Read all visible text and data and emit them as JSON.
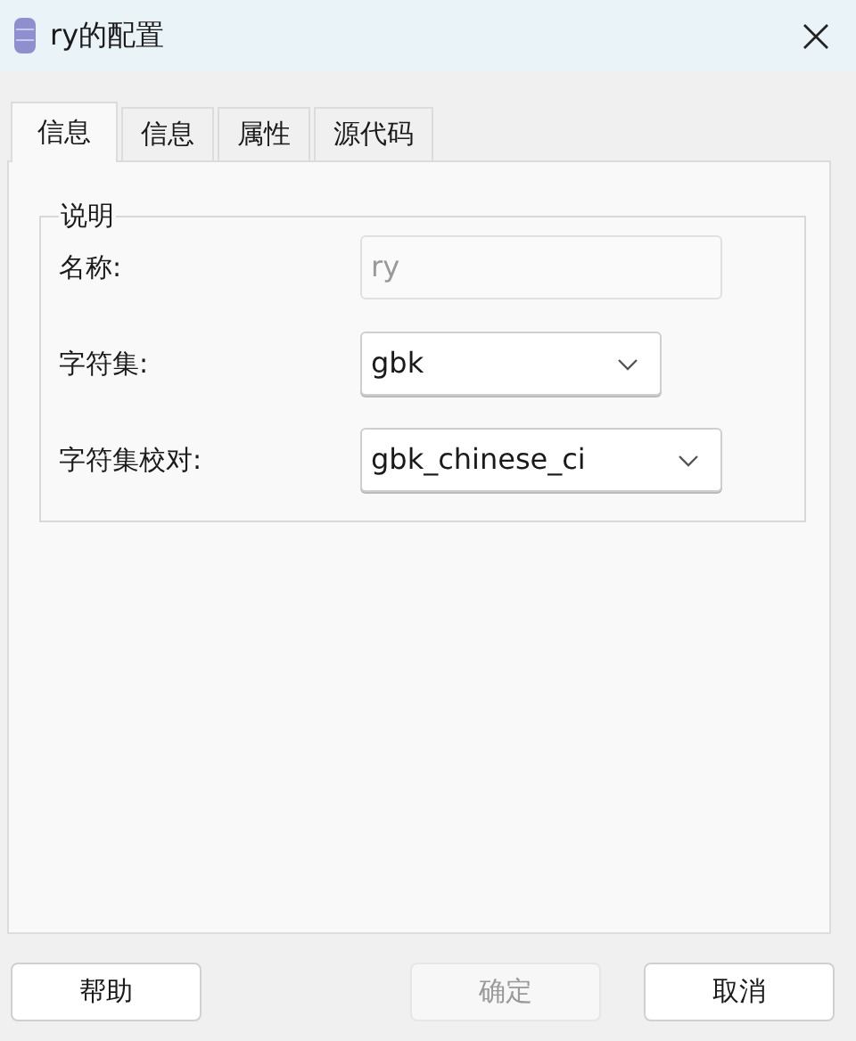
{
  "window": {
    "title": "ry的配置"
  },
  "tabs": [
    {
      "label": "信息",
      "selected": true
    },
    {
      "label": "信息",
      "selected": false
    },
    {
      "label": "属性",
      "selected": false
    },
    {
      "label": "源代码",
      "selected": false
    }
  ],
  "group": {
    "title": "说明",
    "fields": [
      {
        "kind": "text",
        "label": "名称:",
        "value": "ry",
        "disabled": true
      },
      {
        "kind": "select",
        "label": "字符集:",
        "value": "gbk",
        "disabled": false
      },
      {
        "kind": "select",
        "label": "字符集校对:",
        "value": "gbk_chinese_ci",
        "disabled": false
      }
    ]
  },
  "buttons": [
    {
      "label": "帮助",
      "disabled": false
    },
    {
      "label": "确定",
      "disabled": true
    },
    {
      "label": "取消",
      "disabled": false
    }
  ]
}
